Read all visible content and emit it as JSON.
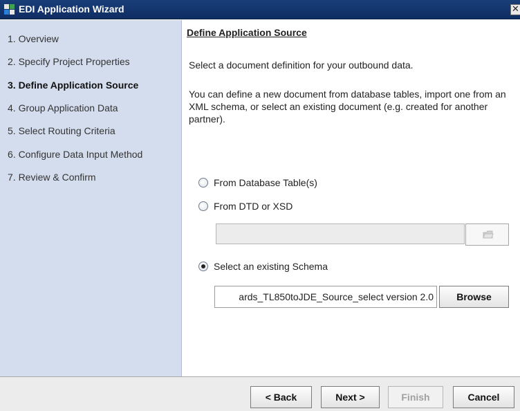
{
  "window": {
    "title": "EDI Application Wizard",
    "close_glyph": "✕"
  },
  "sidebar": {
    "steps": [
      {
        "label": "1. Overview",
        "active": false
      },
      {
        "label": "2. Specify Project Properties",
        "active": false
      },
      {
        "label": "3. Define Application Source",
        "active": true
      },
      {
        "label": "4. Group Application Data",
        "active": false
      },
      {
        "label": "5. Select Routing Criteria",
        "active": false
      },
      {
        "label": "6. Configure Data Input Method",
        "active": false
      },
      {
        "label": "7. Review & Confirm",
        "active": false
      }
    ]
  },
  "main": {
    "heading": "Define Application Source",
    "intro": "Select a document definition for your outbound data.",
    "description": "You can define a new document from database tables, import one from an XML schema, or select an existing document (e.g. created for another partner).",
    "options": {
      "from_database": {
        "label": "From Database Table(s)",
        "selected": false
      },
      "from_dtd": {
        "label": "From DTD or XSD",
        "selected": false
      },
      "existing_schema": {
        "label": "Select an existing Schema",
        "selected": true
      }
    },
    "dtd_path_value": "",
    "schema_value": "ards_TL850toJDE_Source_select version 2.0",
    "browse_label": "Browse"
  },
  "footer": {
    "back_label": "< Back",
    "next_label": "Next >",
    "finish_label": "Finish",
    "cancel_label": "Cancel"
  },
  "colors": {
    "titlebar": "#0e2d63",
    "sidebar": "#d4ddee",
    "footer": "#ececec"
  },
  "icons": {
    "app": "app-grid-icon",
    "close": "close-icon",
    "folder": "folder-icon"
  }
}
